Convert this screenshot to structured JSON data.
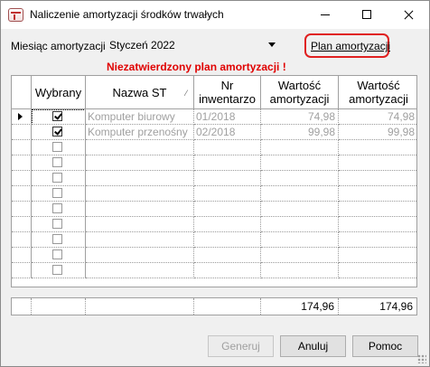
{
  "window": {
    "title": "Naliczenie amortyzacji środków trwałych"
  },
  "form": {
    "month_label": "Miesiąc amortyzacji:",
    "month_value": "Styczeń 2022",
    "plan_link": "Plan amortyzacji",
    "warning": "Niezatwierdzony plan amortyzacji !"
  },
  "grid": {
    "columns": [
      {
        "label": "Wybrany"
      },
      {
        "label": "Nazwa ST"
      },
      {
        "label": "Nr\ninwentarzo"
      },
      {
        "label": "Wartość\namortyzacji"
      },
      {
        "label": "Wartość\namortyzacji"
      }
    ],
    "rows": [
      {
        "selected": true,
        "name": "Komputer biurowy",
        "inv": "01/2018",
        "v1": "74,98",
        "v2": "74,98",
        "current": true
      },
      {
        "selected": true,
        "name": "Komputer przenośny",
        "inv": "02/2018",
        "v1": "99,98",
        "v2": "99,98",
        "current": false
      },
      {
        "selected": false,
        "name": "",
        "inv": "",
        "v1": "",
        "v2": ""
      },
      {
        "selected": false,
        "name": "",
        "inv": "",
        "v1": "",
        "v2": ""
      },
      {
        "selected": false,
        "name": "",
        "inv": "",
        "v1": "",
        "v2": ""
      },
      {
        "selected": false,
        "name": "",
        "inv": "",
        "v1": "",
        "v2": ""
      },
      {
        "selected": false,
        "name": "",
        "inv": "",
        "v1": "",
        "v2": ""
      },
      {
        "selected": false,
        "name": "",
        "inv": "",
        "v1": "",
        "v2": ""
      },
      {
        "selected": false,
        "name": "",
        "inv": "",
        "v1": "",
        "v2": ""
      },
      {
        "selected": false,
        "name": "",
        "inv": "",
        "v1": "",
        "v2": ""
      },
      {
        "selected": false,
        "name": "",
        "inv": "",
        "v1": "",
        "v2": ""
      }
    ],
    "totals": {
      "v1": "174,96",
      "v2": "174,96"
    }
  },
  "buttons": {
    "generate": "Generuj",
    "cancel": "Anuluj",
    "help": "Pomoc"
  },
  "colors": {
    "warning": "#e00000",
    "highlight_border": "#e02020",
    "disabled_text": "#a0a0a0"
  }
}
